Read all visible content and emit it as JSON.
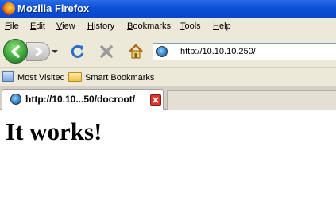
{
  "window": {
    "title": "Mozilla Firefox"
  },
  "menu": {
    "file": {
      "accel": "F",
      "rest": "ile"
    },
    "edit": {
      "accel": "E",
      "rest": "dit"
    },
    "view": {
      "accel": "V",
      "rest": "iew"
    },
    "history": {
      "accel": "H",
      "rest": "istory"
    },
    "bookmarks": {
      "accel": "B",
      "rest": "ookmarks"
    },
    "tools": {
      "accel": "T",
      "rest": "ools"
    },
    "help": {
      "accel": "H",
      "rest": "elp"
    }
  },
  "nav": {
    "url": "http://10.10.10.250/"
  },
  "bookmarks": {
    "most_visited": "Most Visited",
    "smart_bookmarks": "Smart Bookmarks"
  },
  "tab": {
    "label": "http://10.10...50/docroot/"
  },
  "page": {
    "heading": "It works!"
  },
  "icons": {
    "firefox": "firefox-logo-icon",
    "back": "back-arrow-icon",
    "forward": "forward-arrow-icon",
    "history_dropdown": "dropdown-arrow-icon",
    "reload": "reload-icon",
    "stop": "stop-icon",
    "home": "home-icon",
    "site": "globe-icon",
    "most_visited": "bookmark-folder-icon",
    "smart_bookmarks": "folder-icon",
    "tab_close": "close-icon"
  },
  "colors": {
    "titlebar": "#0a4fd8",
    "chrome": "#ece9d8",
    "back_button": "#3aa43a",
    "close": "#d9382d"
  }
}
